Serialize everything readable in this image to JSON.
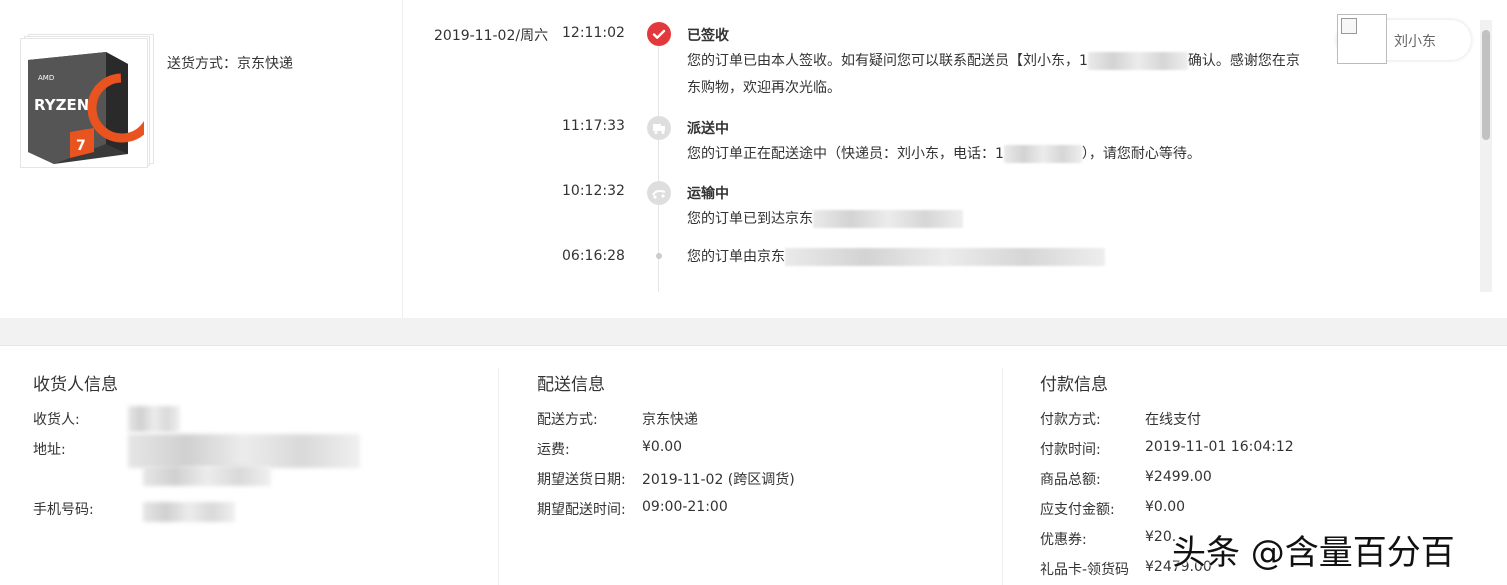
{
  "product": {
    "image_name": "ryzen-7-box",
    "ship_label": "送货方式：京东快递"
  },
  "timeline": {
    "date": "2019-11-02/周六",
    "events": [
      {
        "time": "12:11:02",
        "title": "已签收",
        "line1_a": "您的订单已由本人签收。如有疑问您可以联系配送员【刘小东，1",
        "line1_b": "确认。感谢您在京",
        "line2": "东购物，欢迎再次光临。"
      },
      {
        "time": "11:17:33",
        "title": "派送中",
        "line1_a": "您的订单正在配送途中（快递员：刘小东，电话：1",
        "line1_b": "），请您耐心等待。"
      },
      {
        "time": "10:12:32",
        "title": "运输中",
        "line1_a": "您的订单已到达京东"
      },
      {
        "time": "06:16:28",
        "line1_a": "您的订单由京东"
      }
    ]
  },
  "courier": {
    "name": "刘小东"
  },
  "receiver": {
    "heading": "收货人信息",
    "name_label": "收货人:",
    "address_label": "地址:",
    "phone_label": "手机号码:"
  },
  "delivery": {
    "heading": "配送信息",
    "rows": [
      {
        "k": "配送方式:",
        "v": "京东快递"
      },
      {
        "k": "运费:",
        "v": "¥0.00"
      },
      {
        "k": "期望送货日期:",
        "v": "2019-11-02 (跨区调货)"
      },
      {
        "k": "期望配送时间:",
        "v": "09:00-21:00"
      }
    ]
  },
  "payment": {
    "heading": "付款信息",
    "rows": [
      {
        "k": "付款方式:",
        "v": "在线支付"
      },
      {
        "k": "付款时间:",
        "v": "2019-11-01 16:04:12"
      },
      {
        "k": "商品总额:",
        "v": "¥2499.00"
      },
      {
        "k": "应支付金额:",
        "v": "¥0.00"
      },
      {
        "k": "优惠券:",
        "v": "¥20."
      },
      {
        "k": "礼品卡-领货码",
        "v": "¥2479.00"
      }
    ]
  },
  "watermark": "头条 @含量百分百",
  "colors": {
    "accent": "#e4393c",
    "band": "#f2f2f2"
  }
}
